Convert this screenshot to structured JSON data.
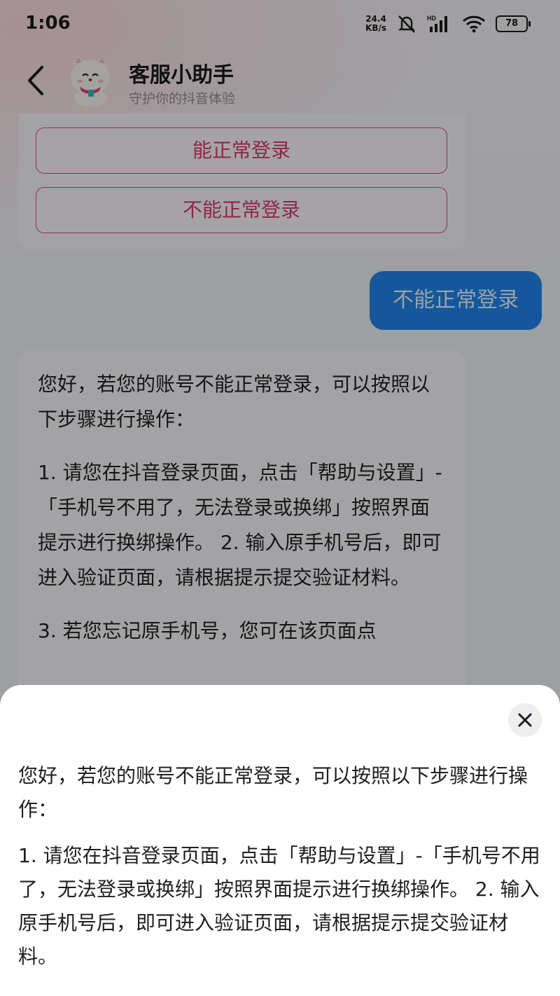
{
  "status_bar": {
    "time": "1:06",
    "net_speed_value": "24.4",
    "net_speed_unit": "KB/s",
    "signal_label": "HD",
    "battery": "78"
  },
  "header": {
    "title": "客服小助手",
    "subtitle": "守护你的抖音体验",
    "avatar_icon": "mascot-avatar-icon"
  },
  "chat": {
    "options": [
      "能正常登录",
      "不能正常登录"
    ],
    "user_message": "不能正常登录",
    "reply_paragraphs": [
      "您好，若您的账号不能正常登录，可以按照以下步骤进行操作：",
      "1. 请您在抖音登录页面，点击「帮助与设置」-「手机号不用了，无法登录或换绑」按照界面提示进行换绑操作。 2. 输入原手机号后，即可进入验证页面，请根据提示提交验证材料。",
      "3. 若您忘记原手机号，您可在该页面点"
    ]
  },
  "sheet": {
    "paragraphs": [
      "您好，若您的账号不能正常登录，可以按照以下步骤进行操作：",
      "1. 请您在抖音登录页面，点击「帮助与设置」-「手机号不用了，无法登录或换绑」按照界面提示进行换绑操作。 2. 输入原手机号后，即可进入验证页面，请根据提示提交验证材料。"
    ]
  },
  "colors": {
    "accent_pink": "#e8437a",
    "user_bubble": "#1f84e8"
  }
}
